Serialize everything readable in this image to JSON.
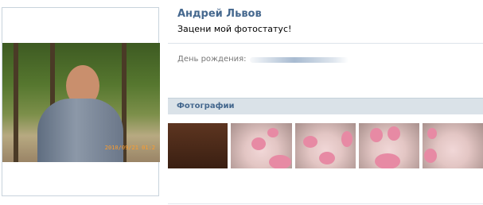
{
  "profile": {
    "name": "Андрей Львов",
    "status": "Зацени мой фотостатус!",
    "avatar_date_stamp": "2010/09/21 01:2"
  },
  "info": {
    "birthday_label": "День рождения:"
  },
  "photos": {
    "header": "Фотографии",
    "thumbnails": [
      "photo-1",
      "photo-2",
      "photo-3",
      "photo-4",
      "photo-5"
    ]
  },
  "colors": {
    "link_blue": "#45688e",
    "header_bg": "#dae2e8"
  }
}
